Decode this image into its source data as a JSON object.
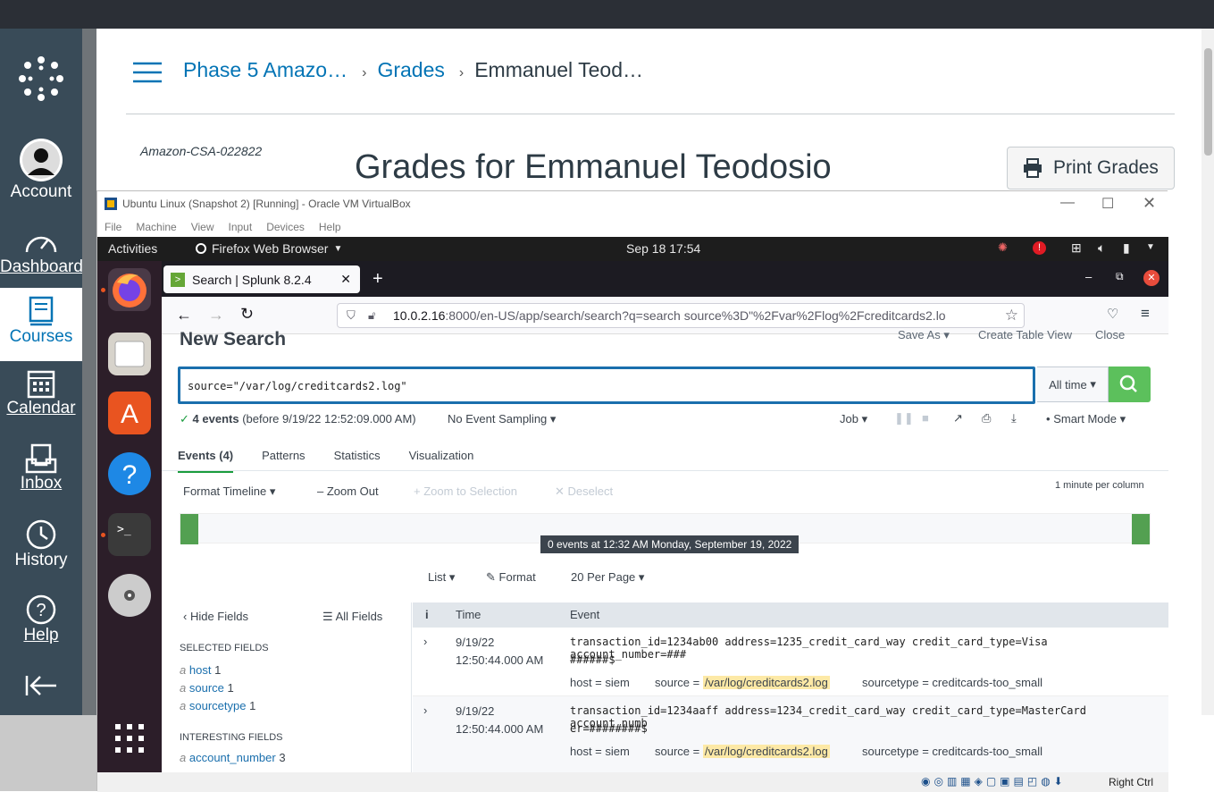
{
  "canvas": {
    "nav": {
      "account": "Account",
      "dashboard": "Dashboard",
      "courses": "Courses",
      "calendar": "Calendar",
      "inbox": "Inbox",
      "history": "History",
      "help": "Help"
    },
    "breadcrumbs": [
      "Phase 5 Amazo…",
      "Grades",
      "Emmanuel Teod…"
    ],
    "course_code": "Amazon-CSA-022822",
    "title": "Grades for Emmanuel Teodosio",
    "print_button": "Print Grades"
  },
  "virtualbox": {
    "title": "Ubuntu Linux (Snapshot 2) [Running] - Oracle VM VirtualBox",
    "menu": [
      "File",
      "Machine",
      "View",
      "Input",
      "Devices",
      "Help"
    ],
    "status_right": "Right Ctrl"
  },
  "gnome": {
    "activities": "Activities",
    "app": "Firefox Web Browser",
    "clock": "Sep 18  17:54"
  },
  "firefox": {
    "tab_title": "Search | Splunk 8.2.4",
    "url_host": "10.0.2.16",
    "url_rest": ":8000/en-US/app/search/search?q=search source%3D\"%2Fvar%2Flog%2Fcreditcards2.lo"
  },
  "splunk": {
    "page_title": "New Search",
    "actions": [
      "Save As",
      "Create Table View",
      "Close"
    ],
    "query": "source=\"/var/log/creditcards2.log\"",
    "time_range": "All time",
    "events_count": "4 events",
    "events_before": "(before 9/19/22 12:52:09.000 AM)",
    "sampling": "No Event Sampling",
    "job": "Job",
    "mode": "Smart Mode",
    "tabs": [
      "Events (4)",
      "Patterns",
      "Statistics",
      "Visualization"
    ],
    "timeline_controls": [
      "Format Timeline",
      "Zoom Out",
      "Zoom to Selection",
      "Deselect"
    ],
    "per_column": "1 minute per column",
    "tooltip": "0 events at 12:32 AM Monday, September 19, 2022",
    "list_controls": [
      "List",
      "Format",
      "20 Per Page"
    ],
    "hide_fields": "Hide Fields",
    "all_fields": "All Fields",
    "selected_fields_label": "SELECTED FIELDS",
    "selected_fields": [
      {
        "name": "host",
        "count": "1"
      },
      {
        "name": "source",
        "count": "1"
      },
      {
        "name": "sourcetype",
        "count": "1"
      }
    ],
    "interesting_fields_label": "INTERESTING FIELDS",
    "interesting_fields": [
      {
        "name": "account_number",
        "count": "3"
      }
    ],
    "col_info": "i",
    "col_time": "Time",
    "col_event": "Event",
    "events": [
      {
        "date": "9/19/22",
        "time": "12:50:44.000 AM",
        "line1": "transaction_id=1234ab00 address=1235_credit_card_way credit_card_type=Visa account_number=###",
        "line2": "######$",
        "host": "siem",
        "source": "/var/log/creditcards2.log",
        "sourcetype": "creditcards-too_small"
      },
      {
        "date": "9/19/22",
        "time": "12:50:44.000 AM",
        "line1": "transaction_id=1234aaff address=1234_credit_card_way credit_card_type=MasterCard account_numb",
        "line2": "er=########$",
        "host": "siem",
        "source": "/var/log/creditcards2.log",
        "sourcetype": "creditcards-too_small"
      }
    ],
    "kv_labels": {
      "host": "host =",
      "source": "source =",
      "sourcetype": "sourcetype ="
    }
  }
}
